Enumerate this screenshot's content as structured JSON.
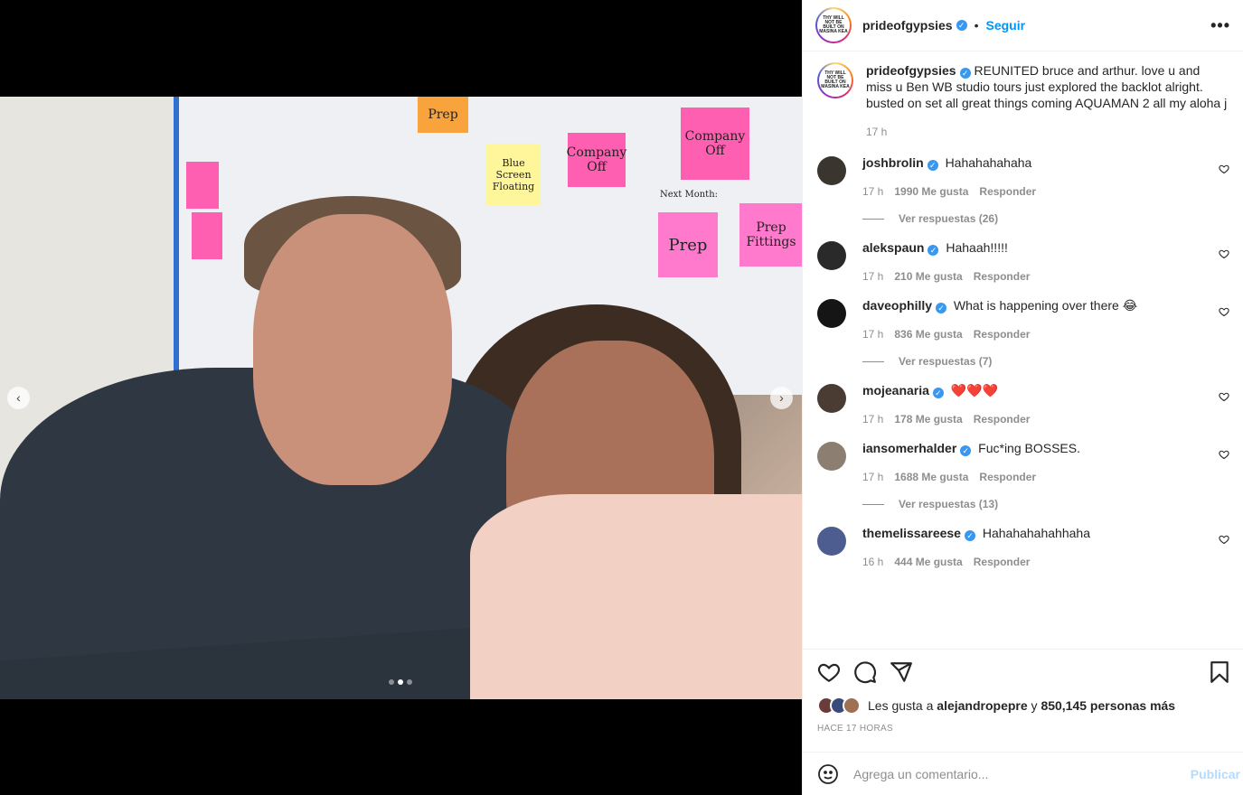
{
  "post": {
    "username": "prideofgypsies",
    "follow_label": "Seguir",
    "separator": "•",
    "more_label": "•••",
    "avatar_text": "THY WILL NOT BE BUILT ON MASINA KEA",
    "caption": "REUNITED bruce and arthur. love u and miss u Ben WB studio tours just explored the backlot alright. busted on set all great things coming AQUAMAN 2 all my aloha j",
    "caption_time": "17 h"
  },
  "photo": {
    "notes": [
      "Prep",
      "Company Off",
      "Company Off",
      "Blue Screen Floating",
      "Prep",
      "Prep Fittings",
      "Next Month:"
    ],
    "carousel_count": 3,
    "carousel_active": 2
  },
  "comments": [
    {
      "user": "joshbrolin",
      "text": "Hahahahahaha",
      "time": "17 h",
      "likes": "1990 Me gusta",
      "reply": "Responder",
      "replies": "Ver respuestas (26)",
      "avatar_color": "#3b3530"
    },
    {
      "user": "alekspaun",
      "text": "Hahaah!!!!!",
      "time": "17 h",
      "likes": "210 Me gusta",
      "reply": "Responder",
      "replies": "",
      "avatar_color": "#2a2a2a"
    },
    {
      "user": "daveophilly",
      "text": "What is happening over there 😂",
      "time": "17 h",
      "likes": "836 Me gusta",
      "reply": "Responder",
      "replies": "Ver respuestas (7)",
      "avatar_color": "#151515"
    },
    {
      "user": "mojeanaria",
      "text": "❤️❤️❤️",
      "time": "17 h",
      "likes": "178 Me gusta",
      "reply": "Responder",
      "replies": "",
      "avatar_color": "#4a3b33"
    },
    {
      "user": "iansomerhalder",
      "text": "Fuc*ing BOSSES.",
      "time": "17 h",
      "likes": "1688 Me gusta",
      "reply": "Responder",
      "replies": "Ver respuestas (13)",
      "avatar_color": "#8c7f72"
    },
    {
      "user": "themelissareese",
      "text": "Hahahahahahhaha",
      "time": "16 h",
      "likes": "444 Me gusta",
      "reply": "Responder",
      "replies": "",
      "avatar_color": "#4d5d8f"
    }
  ],
  "likes": {
    "prefix": "Les gusta a",
    "user": "alejandropepre",
    "middle": "y",
    "count": "850,145 personas más"
  },
  "ago": "HACE 17 HORAS",
  "composer": {
    "placeholder": "Agrega un comentario...",
    "publish_label": "Publicar"
  },
  "colors": {
    "accent": "#0095f6",
    "verified": "#3897f0",
    "muted": "#8e8e8e",
    "publish_disabled": "#b3dbff"
  },
  "icons": {
    "verified": "✓",
    "prev": "‹",
    "next": "›"
  }
}
